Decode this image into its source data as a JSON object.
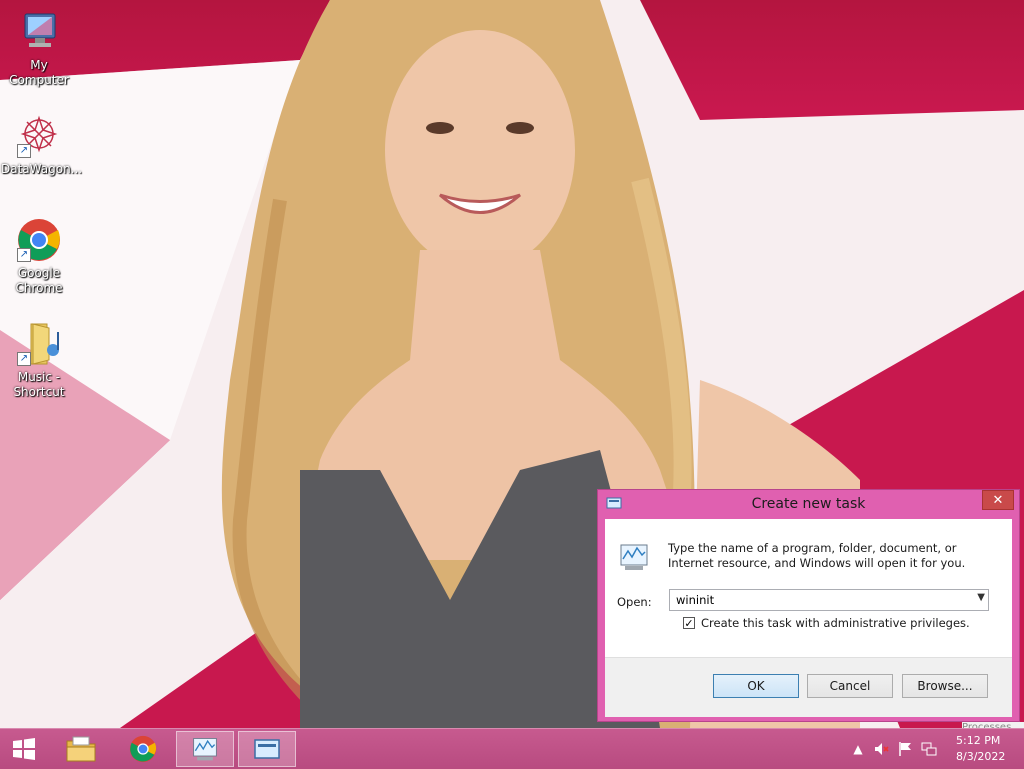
{
  "desktop": {
    "icons": [
      {
        "label": "My Computer",
        "icon": "my-computer-icon"
      },
      {
        "label": "DataWagon...",
        "icon": "datawagon-icon"
      },
      {
        "label": "Google Chrome",
        "icon": "chrome-icon"
      },
      {
        "label": "Music - Shortcut",
        "icon": "music-folder-icon"
      }
    ]
  },
  "dialog": {
    "title": "Create new task",
    "close_glyph": "✕",
    "description": "Type the name of a program, folder, document, or Internet resource, and Windows will open it for you.",
    "open_label": "Open:",
    "open_value": "wininit",
    "checkbox_label": "Create this task with administrative privileges.",
    "checkbox_checked": true,
    "buttons": {
      "ok": "OK",
      "cancel": "Cancel",
      "browse": "Browse..."
    }
  },
  "taskbar": {
    "items": [
      {
        "icon": "start-icon"
      },
      {
        "icon": "file-explorer-icon"
      },
      {
        "icon": "chrome-icon"
      },
      {
        "icon": "task-manager-icon"
      },
      {
        "icon": "run-dialog-icon",
        "active": true
      }
    ],
    "tray": {
      "show_hidden_glyph": "▲",
      "clock_time": "5:12 PM",
      "clock_date": "8/3/2022",
      "ghost_text": "Processes"
    }
  },
  "colors": {
    "wallpaper_pink": "#c8184e",
    "dialog_frame": "#e060b0",
    "taskbar": "#c75a8f",
    "close_button": "#c94a4a"
  }
}
